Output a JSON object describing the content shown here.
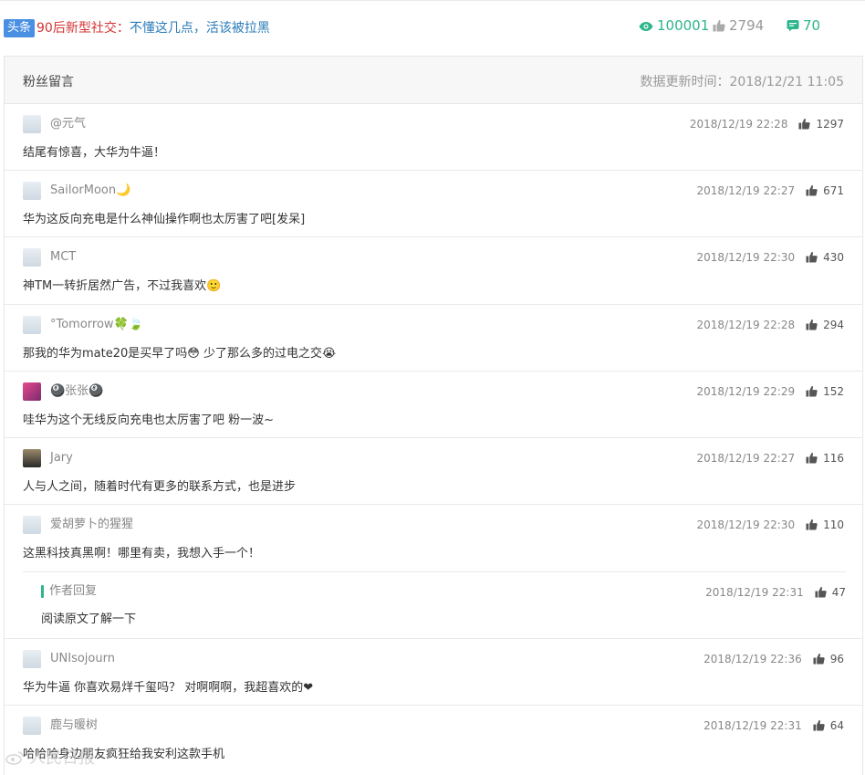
{
  "article": {
    "tag": "头条",
    "title_red": "90后新型社交：",
    "title_blue": "不懂这几点，活该被拉黑",
    "views": "100001",
    "likes": "2794",
    "comments": "70"
  },
  "panel": {
    "title": "粉丝留言",
    "update_time": "数据更新时间：2018/12/21 11:05"
  },
  "comments": [
    {
      "user": "@元气",
      "date": "2018/12/19 22:28",
      "likes": "1297",
      "text": "结尾有惊喜，大华为牛逼！"
    },
    {
      "user": "SailorMoon🌙",
      "date": "2018/12/19 22:27",
      "likes": "671",
      "text": "华为这反向充电是什么神仙操作啊也太厉害了吧[发呆]"
    },
    {
      "user": "MCT",
      "date": "2018/12/19 22:30",
      "likes": "430",
      "text": "神TM一转折居然广告，不过我喜欢🙂"
    },
    {
      "user": "°Tomorrow🍀🍃",
      "date": "2018/12/19 22:28",
      "likes": "294",
      "text": "那我的华为mate20是买早了吗😳 少了那么多的过电之交😭"
    },
    {
      "user": "🎱张张🎱",
      "date": "2018/12/19 22:29",
      "likes": "152",
      "text": "哇华为这个无线反向充电也太厉害了吧 粉一波~"
    },
    {
      "user": "Jary",
      "date": "2018/12/19 22:27",
      "likes": "116",
      "text": "人与人之间，随着时代有更多的联系方式，也是进步"
    },
    {
      "user": "爱胡萝卜的猩猩",
      "date": "2018/12/19 22:30",
      "likes": "110",
      "text": "这黑科技真黑啊！哪里有卖，我想入手一个！"
    },
    {
      "user": "UNIsojourn",
      "date": "2018/12/19 22:36",
      "likes": "96",
      "text": "华为牛逼 你喜欢易烊千玺吗？ 对啊啊啊，我超喜欢的❤"
    },
    {
      "user": "鹿与暖树",
      "date": "2018/12/19 22:31",
      "likes": "64",
      "text": "哈哈哈身边朋友疯狂给我安利这款手机"
    }
  ],
  "reply": {
    "label": "作者回复",
    "date": "2018/12/19 22:31",
    "likes": "47",
    "text": "阅读原文了解一下"
  },
  "watermark": "人民日报",
  "colors": {
    "accent_green": "#2db58c",
    "title_red": "#d43333",
    "title_blue": "#2b7bb9",
    "tag_blue": "#4a90e2"
  }
}
